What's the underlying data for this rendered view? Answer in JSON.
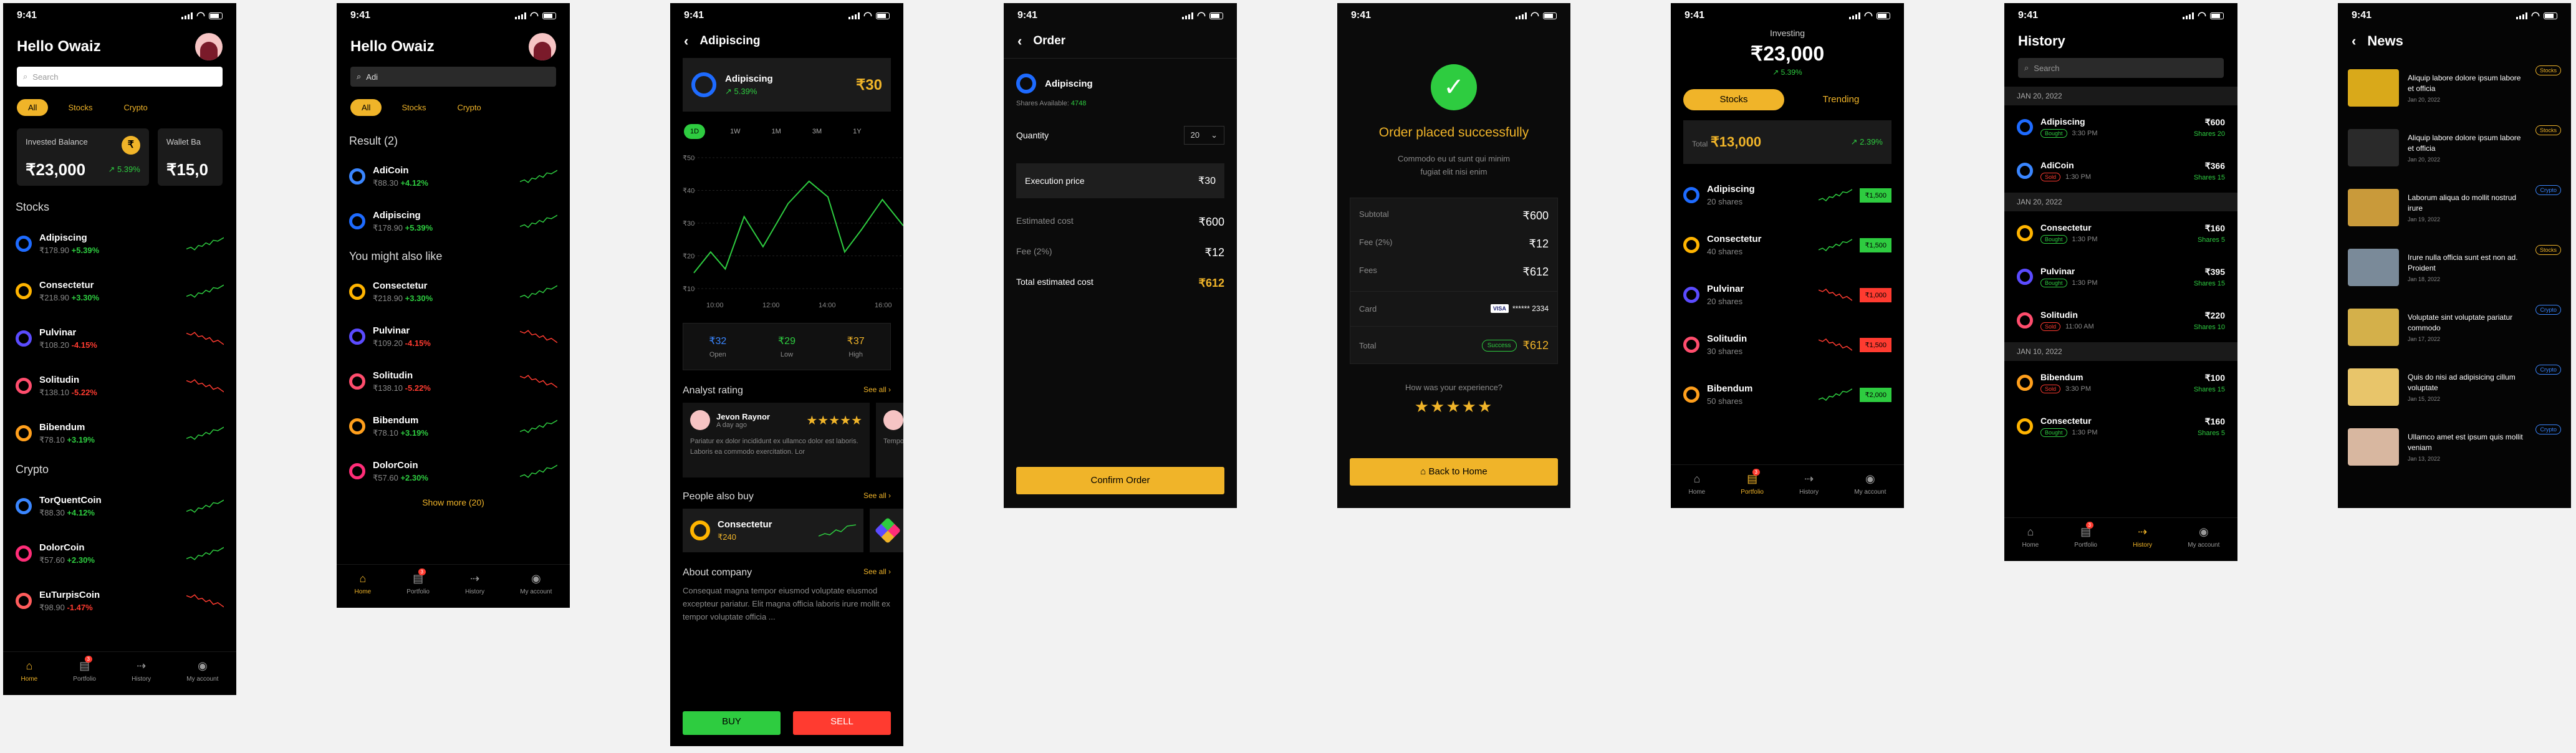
{
  "status_time": "9:41",
  "tabs": {
    "home": "Home",
    "portfolio": "Portfolio",
    "history": "History",
    "account": "My account",
    "badge": "3"
  },
  "p1": {
    "greeting": "Hello Owaiz",
    "search_placeholder": "Search",
    "filters": [
      "All",
      "Stocks",
      "Crypto"
    ],
    "invested_label": "Invested Balance",
    "invested_value": "₹23,000",
    "invested_change": "5.39%",
    "wallet_label": "Wallet Ba",
    "wallet_value": "₹15,0",
    "stocks_title": "Stocks",
    "crypto_title": "Crypto",
    "stocks": [
      {
        "name": "Adipiscing",
        "price": "₹178.90",
        "chg": "+5.39%",
        "up": true,
        "color": "#1e6bff"
      },
      {
        "name": "Consectetur",
        "price": "₹218.90",
        "chg": "+3.30%",
        "up": true,
        "color": "#ffb400"
      },
      {
        "name": "Pulvinar",
        "price": "₹108.20",
        "chg": "-4.15%",
        "up": false,
        "color": "#5b4bff"
      },
      {
        "name": "Solitudin",
        "price": "₹138.10",
        "chg": "-5.22%",
        "up": false,
        "color": "#ff4d6d"
      },
      {
        "name": "Bibendum",
        "price": "₹78.10",
        "chg": "+3.19%",
        "up": true,
        "color": "#ff9f1c"
      }
    ],
    "crypto": [
      {
        "name": "TorQuentCoin",
        "price": "₹88.30",
        "chg": "+4.12%",
        "up": true,
        "color": "#3a86ff"
      },
      {
        "name": "DolorCoin",
        "price": "₹57.60",
        "chg": "+2.30%",
        "up": true,
        "color": "#ff2d78"
      },
      {
        "name": "EuTurpisCoin",
        "price": "₹98.90",
        "chg": "-1.47%",
        "up": false,
        "color": "#ff5c5c"
      }
    ]
  },
  "p2": {
    "greeting": "Hello Owaiz",
    "search_value": "Adi",
    "filters": [
      "All",
      "Stocks",
      "Crypto"
    ],
    "result_title": "Result (2)",
    "also_title": "You might also like",
    "show_more": "Show more (20)",
    "results": [
      {
        "name": "AdiCoin",
        "price": "₹88.30",
        "chg": "+4.12%",
        "up": true,
        "color": "#3a86ff"
      },
      {
        "name": "Adipiscing",
        "price": "₹178.90",
        "chg": "+5.39%",
        "up": true,
        "color": "#1e6bff"
      }
    ],
    "also": [
      {
        "name": "Consectetur",
        "price": "₹218.90",
        "chg": "+3.30%",
        "up": true,
        "color": "#ffb400"
      },
      {
        "name": "Pulvinar",
        "price": "₹109.20",
        "chg": "-4.15%",
        "up": false,
        "color": "#5b4bff"
      },
      {
        "name": "Solitudin",
        "price": "₹138.10",
        "chg": "-5.22%",
        "up": false,
        "color": "#ff4d6d"
      },
      {
        "name": "Bibendum",
        "price": "₹78.10",
        "chg": "+3.19%",
        "up": true,
        "color": "#ff9f1c"
      },
      {
        "name": "DolorCoin",
        "price": "₹57.60",
        "chg": "+2.30%",
        "up": true,
        "color": "#ff2d78"
      }
    ]
  },
  "p3": {
    "title": "Adipiscing",
    "name": "Adipiscing",
    "chg": "5.39%",
    "price": "₹30",
    "ranges": [
      "1D",
      "1W",
      "1M",
      "3M",
      "1Y"
    ],
    "ytick": [
      "₹50",
      "₹40",
      "₹30",
      "₹20",
      "₹10"
    ],
    "xtick": [
      "10:00",
      "12:00",
      "14:00",
      "16:00"
    ],
    "open_v": "₹32",
    "open_l": "Open",
    "low_v": "₹29",
    "low_l": "Low",
    "high_v": "₹37",
    "high_l": "High",
    "analyst_title": "Analyst rating",
    "see_all": "See all",
    "reviewer": "Jevon Raynor",
    "review_time": "A day ago",
    "review": "Pariatur ex dolor incididunt ex ullamco dolor est laboris. Laboris ea commodo exercitation. Lor",
    "review2": "Tempor ... aute cup... cu",
    "also_title": "People also buy",
    "also_name": "Consectetur",
    "also_price": "₹240",
    "about_title": "About company",
    "about_text": "Consequat magna tempor eiusmod voluptate eiusmod excepteur pariatur. Elit magna officia laboris irure mollit ex tempor voluptate officia ...",
    "buy": "BUY",
    "sell": "SELL"
  },
  "p4": {
    "title": "Order",
    "name": "Adipiscing",
    "shares_label": "Shares Available:",
    "shares_value": "4748",
    "qty_label": "Quantity",
    "qty_value": "20",
    "exec_label": "Execution price",
    "exec_value": "₹30",
    "est_label": "Estimated cost",
    "est_value": "₹600",
    "fee_label": "Fee (2%)",
    "fee_value": "₹12",
    "total_label": "Total estimated cost",
    "total_value": "₹612",
    "confirm": "Confirm Order"
  },
  "p5": {
    "title": "Order placed successfully",
    "sub": "Commodo eu ut sunt qui minim fugiat elit nisi enim",
    "subtotal_l": "Subtotal",
    "subtotal_v": "₹600",
    "fee_l": "Fee (2%)",
    "fee_v": "₹12",
    "fees_l": "Fees",
    "fees_v": "₹612",
    "card_l": "Card",
    "card_brand": "VISA",
    "card_num": "****** 2334",
    "total_l": "Total",
    "total_badge": "Success",
    "total_v": "₹612",
    "exp_q": "How was your experience?",
    "back": "Back to Home"
  },
  "p6": {
    "label": "Investing",
    "value": "₹23,000",
    "chg": "5.39%",
    "tab_stocks": "Stocks",
    "tab_trending": "Trending",
    "total_l": "Total",
    "total_v": "₹13,000",
    "total_chg": "2.39%",
    "items": [
      {
        "name": "Adipiscing",
        "shares": "20 shares",
        "price": "₹1,500",
        "up": true,
        "color": "#1e6bff"
      },
      {
        "name": "Consectetur",
        "shares": "40 shares",
        "price": "₹1,500",
        "up": true,
        "color": "#ffb400"
      },
      {
        "name": "Pulvinar",
        "shares": "20 shares",
        "price": "₹1,000",
        "up": false,
        "color": "#5b4bff"
      },
      {
        "name": "Solitudin",
        "shares": "30 shares",
        "price": "₹1,500",
        "up": false,
        "color": "#ff4d6d"
      },
      {
        "name": "Bibendum",
        "shares": "50 shares",
        "price": "₹2,000",
        "up": true,
        "color": "#ff9f1c"
      }
    ]
  },
  "p7": {
    "title": "History",
    "search_placeholder": "Search",
    "groups": [
      {
        "date": "JAN 20, 2022",
        "items": [
          {
            "name": "Adipiscing",
            "tag": "Bought",
            "time": "3:30 PM",
            "price": "₹600",
            "shares": "Shares 20",
            "buy": true,
            "color": "#1e6bff"
          },
          {
            "name": "AdiCoin",
            "tag": "Sold",
            "time": "1:30 PM",
            "price": "₹366",
            "shares": "Shares 15",
            "buy": false,
            "color": "#3a86ff"
          }
        ]
      },
      {
        "date": "JAN 20, 2022",
        "items": [
          {
            "name": "Consectetur",
            "tag": "Bought",
            "time": "1:30 PM",
            "price": "₹160",
            "shares": "Shares 5",
            "buy": true,
            "color": "#ffb400"
          },
          {
            "name": "Pulvinar",
            "tag": "Bought",
            "time": "1:30 PM",
            "price": "₹395",
            "shares": "Shares 15",
            "buy": true,
            "color": "#5b4bff"
          },
          {
            "name": "Solitudin",
            "tag": "Sold",
            "time": "11:00 AM",
            "price": "₹220",
            "shares": "Shares 10",
            "buy": false,
            "color": "#ff4d6d"
          }
        ]
      },
      {
        "date": "JAN 10, 2022",
        "items": [
          {
            "name": "Bibendum",
            "tag": "Sold",
            "time": "3:30 PM",
            "price": "₹100",
            "shares": "Shares 15",
            "buy": false,
            "color": "#ff9f1c"
          },
          {
            "name": "Consectetur",
            "tag": "Bought",
            "time": "1:30 PM",
            "price": "₹160",
            "shares": "Shares 5",
            "buy": true,
            "color": "#ffb400"
          }
        ]
      }
    ]
  },
  "p8": {
    "title": "News",
    "items": [
      {
        "t": "Aliquip labore dolore ipsum labore et officia",
        "d": "Jan 20, 2022",
        "tag": "Stocks",
        "tc": "#f0b429",
        "img": "#d9a91a"
      },
      {
        "t": "Aliquip labore dolore ipsum labore et officia",
        "d": "Jan 20, 2022",
        "tag": "Stocks",
        "tc": "#f0b429",
        "img": "#2a2a2a"
      },
      {
        "t": "Laborum aliqua do mollit nostrud irure",
        "d": "Jan 19, 2022",
        "tag": "Crypto",
        "tc": "#3a86ff",
        "img": "#c99a3a"
      },
      {
        "t": "Irure nulla officia sunt est non ad. Proident",
        "d": "Jan 18, 2022",
        "tag": "Stocks",
        "tc": "#f0b429",
        "img": "#7a8a99"
      },
      {
        "t": "Voluptate sint voluptate pariatur commodo",
        "d": "Jan 17, 2022",
        "tag": "Crypto",
        "tc": "#3a86ff",
        "img": "#d4b04a"
      },
      {
        "t": "Quis do nisi ad adipisicing cillum voluptate",
        "d": "Jan 15, 2022",
        "tag": "Crypto",
        "tc": "#3a86ff",
        "img": "#e8c56a"
      },
      {
        "t": "Ullamco amet est ipsum quis mollit veniam",
        "d": "Jan 13, 2022",
        "tag": "Crypto",
        "tc": "#3a86ff",
        "img": "#d8b7a0"
      }
    ]
  }
}
